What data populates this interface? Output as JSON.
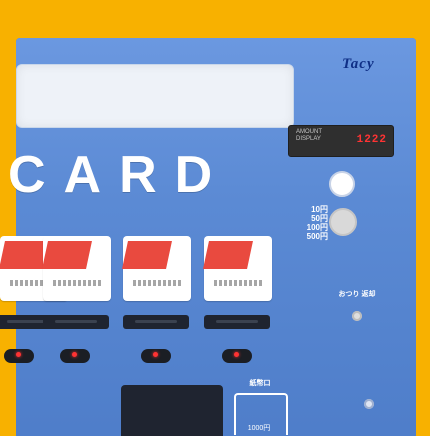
{
  "brand": {
    "logo_text": "Tacy"
  },
  "main_window": {
    "label": "CARD"
  },
  "display": {
    "label": "AMOUNT\nDISPLAY",
    "value": "1222"
  },
  "coin_denominations": [
    "10円",
    "50円",
    "100円",
    "500円"
  ],
  "ticket_cards": [
    {
      "name": "ticket-card-1"
    },
    {
      "name": "ticket-card-2"
    },
    {
      "name": "ticket-card-3"
    },
    {
      "name": "ticket-card-4"
    }
  ],
  "labels": {
    "change_return": "おつり\n返却",
    "bill_slot": "紙幣口",
    "bill_amount": "1000円"
  },
  "colors": {
    "background": "#f8b100",
    "panel": "#5f8fd8",
    "card_red": "#e94a3f",
    "led_red": "#ff3333"
  }
}
